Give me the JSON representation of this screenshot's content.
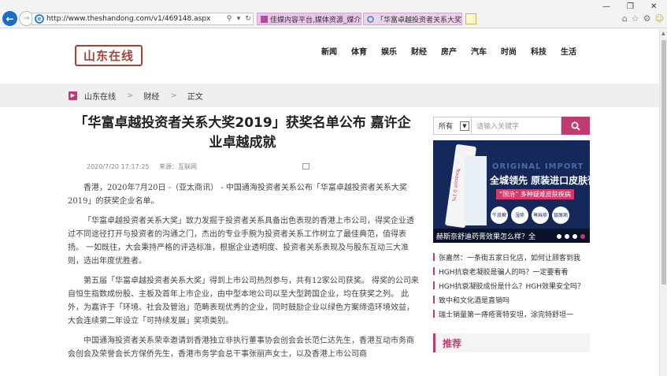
{
  "browser": {
    "url": "http://www.theshandong.com/v1/469148.aspx",
    "tabs": [
      {
        "label": "佳媒内容平台,媒体资源_媒介资..."
      },
      {
        "label": "「华富卓越投资者关系大奖2..."
      }
    ],
    "icons": [
      "back-icon",
      "forward-icon",
      "ie-icon",
      "search-icon",
      "refresh-icon",
      "home-icon",
      "star-icon",
      "gear-icon",
      "smiley-icon"
    ]
  },
  "site": {
    "logo": "山东在线",
    "nav": [
      "新闻",
      "体育",
      "娱乐",
      "财经",
      "房产",
      "汽车",
      "时尚",
      "科技",
      "生活"
    ]
  },
  "breadcrumb": {
    "items": [
      "山东在线",
      "财经",
      "正文"
    ],
    "separator": ">"
  },
  "article": {
    "title": "「华富卓越投资者关系大奖2019」获奖名单公布 嘉许企业卓越成就",
    "date": "2020/7/20 17:17:25",
    "source": "来源：互联网",
    "paragraphs": [
      "香港，2020年7月20日 -（亚太商讯） - 中国通海投资者关系公布「华富卓越投资者关系大奖2019」的获奖企业名单。",
      "「华富卓越投资者关系大奖」致力发掘于投资者关系具备出色表现的香港上市公司，得奖企业透过不同途径打开与投资者的沟通之门，杰出的专业手腕为投资者关系工作树立了最佳典范，值得表扬。 一如既往，大会秉持严格的评选标准，根据企业透明度、投资者关系表现及与股东互动三大准则，选出年度优胜者。",
      "第五届「华富卓越投资者关系大奖」得到上市公司热烈参与，共有12家公司获奖。 得奖的公司来自恒生指数成份股、主板及首年上市企业，由中型本地公司以至大型跨国企业，均在获奖之列。 此外，为嘉许于「环境、社会及管治」范畴表现优秀的企业，同时鼓励企业以绿色方案缔造环境效益，大会连续第二年设立「可持续发展」奖项类别。",
      "中国通海投资者关系荣幸邀请到香港独立非执行董事协会创会会长范仁达先生，香港互动市务商会创会及荣誉会长方保侨先生，香港市务学会总干事张丽声女士，以及香港上市公司商"
    ]
  },
  "sidebar": {
    "search": {
      "select_value": "所有",
      "placeholder": "请输入关键字"
    },
    "banner": {
      "watermark": "ORIGINAL IMPORT",
      "headline": "全城领先 原装进口皮肤膏",
      "subline": "“国治” 多种疑难皮肤疾病",
      "tube_label": "Texacort 0.1%",
      "circles": [
        "牛皮癣",
        "湿疹",
        "荨麻疹",
        "银屑病"
      ],
      "caption": "赫斯奈舒迪药膏效果怎么样？全",
      "slide_index": 4,
      "slide_count": 4
    },
    "news": [
      "张嘉然：一条街五家日化店，如何让顾客到我",
      "HGH抗衰老凝胶是骗人的吗？一定要看看",
      "HGH抗衰凝胶成份是什么？HGH效果安全吗？",
      "致中和文化酒是直销吗",
      "瑞士销量第一痔疮膏特安坦，涂完特舒坦一"
    ],
    "recommend_title": "推荐"
  },
  "colors": {
    "accent": "#c13b73",
    "logo": "#a0453a",
    "banner_bg": "#14295a"
  }
}
